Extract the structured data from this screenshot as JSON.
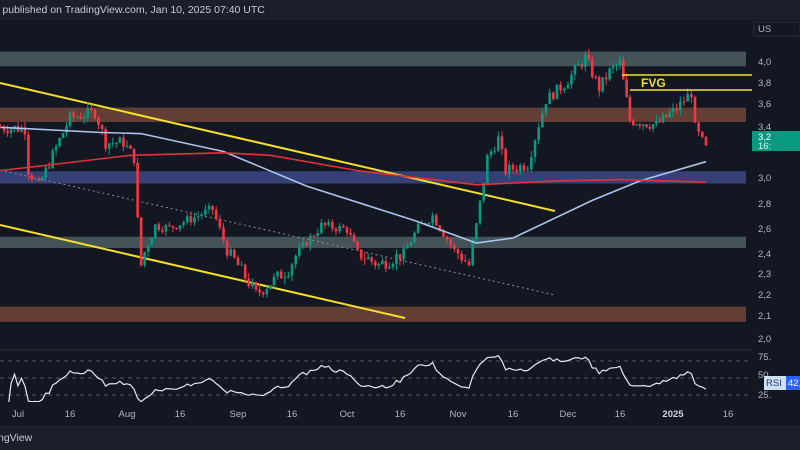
{
  "header": {
    "published_text": "r published on TradingView.com, Jan 10, 2025 07:40 UTC"
  },
  "footer": {
    "logo_text": "ngView"
  },
  "price_scale": {
    "currency_label": "US",
    "ticks": [
      {
        "value": 4000,
        "label": "4,0"
      },
      {
        "value": 3800,
        "label": "3,8"
      },
      {
        "value": 3600,
        "label": "3,6"
      },
      {
        "value": 3400,
        "label": "3,4"
      },
      {
        "value": 3000,
        "label": "3,0"
      },
      {
        "value": 2800,
        "label": "2,8"
      },
      {
        "value": 2600,
        "label": "2,6"
      },
      {
        "value": 2400,
        "label": "2,4"
      },
      {
        "value": 2300,
        "label": "2,3"
      },
      {
        "value": 2200,
        "label": "2,2"
      },
      {
        "value": 2100,
        "label": "2,1"
      },
      {
        "value": 2000,
        "label": "2,0"
      }
    ],
    "last_price_label": "3,2",
    "countdown_label": "16:",
    "last_price_color": "#089981"
  },
  "time_axis": {
    "ticks": [
      {
        "date": "2024-07-01",
        "label": "Jul",
        "bold": false
      },
      {
        "date": "2024-07-16",
        "label": "16",
        "bold": false
      },
      {
        "date": "2024-08-01",
        "label": "Aug",
        "bold": false
      },
      {
        "date": "2024-08-16",
        "label": "16",
        "bold": false
      },
      {
        "date": "2024-09-01",
        "label": "Sep",
        "bold": false
      },
      {
        "date": "2024-09-16",
        "label": "16",
        "bold": false
      },
      {
        "date": "2024-10-01",
        "label": "Oct",
        "bold": false
      },
      {
        "date": "2024-10-16",
        "label": "16",
        "bold": false
      },
      {
        "date": "2024-11-01",
        "label": "Nov",
        "bold": false
      },
      {
        "date": "2024-11-16",
        "label": "16",
        "bold": false
      },
      {
        "date": "2024-12-01",
        "label": "Dec",
        "bold": false
      },
      {
        "date": "2024-12-16",
        "label": "16",
        "bold": false
      },
      {
        "date": "2025-01-01",
        "label": "2025",
        "bold": true
      },
      {
        "date": "2025-01-16",
        "label": "16",
        "bold": false
      }
    ]
  },
  "chart_data": {
    "type": "candlestick",
    "interval": "1D",
    "scale": "log",
    "up_color": "#089981",
    "down_color": "#f23645",
    "price_path": [
      [
        "2024-06-26",
        3390
      ],
      [
        "2024-07-03",
        3380
      ],
      [
        "2024-07-04",
        3050
      ],
      [
        "2024-07-07",
        2930
      ],
      [
        "2024-07-16",
        3470
      ],
      [
        "2024-07-23",
        3520
      ],
      [
        "2024-07-26",
        3270
      ],
      [
        "2024-07-31",
        3270
      ],
      [
        "2024-08-03",
        3150
      ],
      [
        "2024-08-04",
        2660
      ],
      [
        "2024-08-05",
        2340
      ],
      [
        "2024-08-09",
        2620
      ],
      [
        "2024-08-13",
        2600
      ],
      [
        "2024-08-25",
        2750
      ],
      [
        "2024-08-29",
        2420
      ],
      [
        "2024-09-06",
        2200
      ],
      [
        "2024-09-15",
        2320
      ],
      [
        "2024-09-24",
        2620
      ],
      [
        "2024-10-01",
        2590
      ],
      [
        "2024-10-04",
        2400
      ],
      [
        "2024-10-10",
        2340
      ],
      [
        "2024-10-17",
        2400
      ],
      [
        "2024-10-21",
        2600
      ],
      [
        "2024-10-25",
        2700
      ],
      [
        "2024-10-31",
        2420
      ],
      [
        "2024-11-04",
        2340
      ],
      [
        "2024-11-06",
        2620
      ],
      [
        "2024-11-09",
        3150
      ],
      [
        "2024-11-12",
        3300
      ],
      [
        "2024-11-14",
        3050
      ],
      [
        "2024-11-20",
        3100
      ],
      [
        "2024-11-25",
        3630
      ],
      [
        "2024-11-30",
        3780
      ],
      [
        "2024-12-06",
        4030
      ],
      [
        "2024-12-10",
        3740
      ],
      [
        "2024-12-13",
        3900
      ],
      [
        "2024-12-16",
        3980
      ],
      [
        "2024-12-19",
        3450
      ],
      [
        "2024-12-27",
        3410
      ],
      [
        "2025-01-02",
        3550
      ],
      [
        "2025-01-06",
        3700
      ],
      [
        "2025-01-07",
        3380
      ],
      [
        "2025-01-10",
        3220
      ]
    ],
    "moving_averages": [
      {
        "color": "#a9c4ee",
        "points": [
          [
            "2024-06-26",
            3390
          ],
          [
            "2024-07-24",
            3350
          ],
          [
            "2024-08-05",
            3340
          ],
          [
            "2024-08-28",
            3200
          ],
          [
            "2024-09-20",
            2930
          ],
          [
            "2024-10-20",
            2660
          ],
          [
            "2024-11-06",
            2480
          ],
          [
            "2024-11-16",
            2520
          ],
          [
            "2024-12-08",
            2820
          ],
          [
            "2024-12-22",
            2970
          ],
          [
            "2025-01-10",
            3120
          ]
        ]
      },
      {
        "color": "#e5303a",
        "points": [
          [
            "2024-06-26",
            3050
          ],
          [
            "2024-08-02",
            3170
          ],
          [
            "2024-08-28",
            3190
          ],
          [
            "2024-09-10",
            3170
          ],
          [
            "2024-10-04",
            3050
          ],
          [
            "2024-11-06",
            2940
          ],
          [
            "2024-11-28",
            2970
          ],
          [
            "2024-12-16",
            2980
          ],
          [
            "2025-01-10",
            2960
          ]
        ]
      }
    ],
    "zones": [
      {
        "from": 3950,
        "to": 4090,
        "color": "#4a5a5e"
      },
      {
        "from": 3435,
        "to": 3560,
        "color": "#6b4336"
      },
      {
        "from": 2950,
        "to": 3045,
        "color": "#3a4580"
      },
      {
        "from": 2440,
        "to": 2530,
        "color": "#4a5a5e"
      },
      {
        "from": 2070,
        "to": 2140,
        "color": "#6b4336"
      }
    ],
    "annotation_label": "FVG",
    "annotation_color": "#f5e02a"
  },
  "rsi": {
    "label": "RSI",
    "value_label": "42,",
    "levels": [
      {
        "value": 75,
        "label": "75."
      },
      {
        "value": 50,
        "label": "50."
      },
      {
        "value": 25,
        "label": "25."
      }
    ],
    "line_color": "#e8eaf0"
  }
}
